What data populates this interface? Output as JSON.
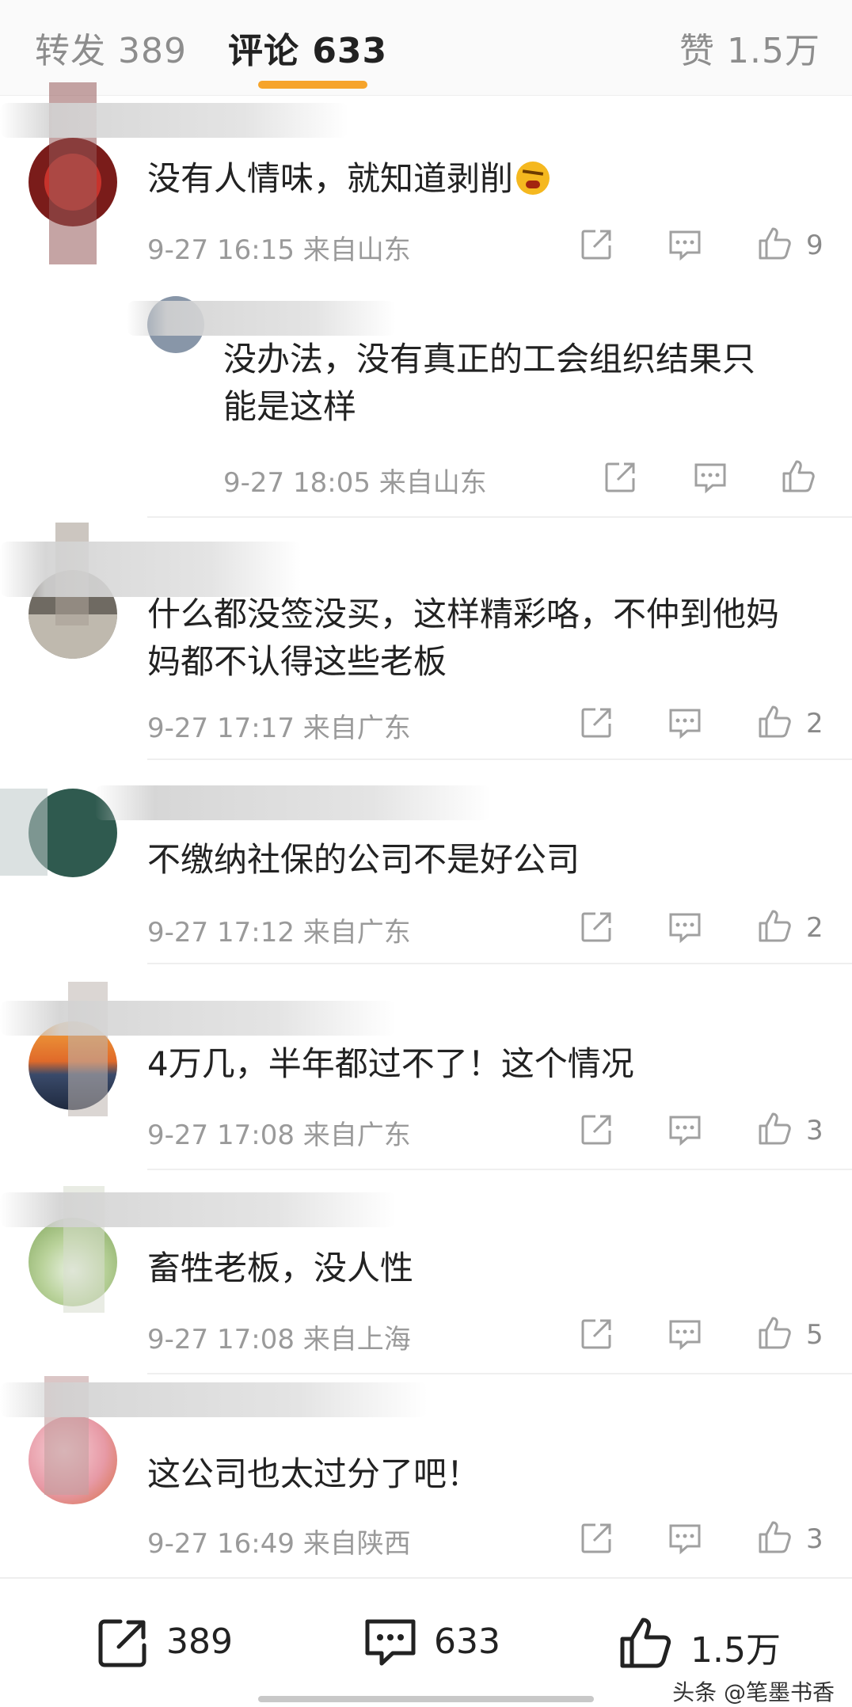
{
  "tabs": {
    "forward": "转发 389",
    "comments": "评论 633",
    "likes": "赞 1.5万"
  },
  "comments": [
    {
      "text": "没有人情味，就知道剥削",
      "time": "9-27 16:15",
      "location": "来自山东",
      "likes": "9"
    },
    {
      "text_line1": "没办法，没有真正的工会组织结果只",
      "text_line2": "能是这样",
      "time": "9-27 18:05",
      "location": "来自山东",
      "likes": ""
    },
    {
      "text_line1": "什么都没签没买，这样精彩咯，不仲到他妈",
      "text_line2": "妈都不认得这些老板",
      "time": "9-27 17:17",
      "location": "来自广东",
      "likes": "2"
    },
    {
      "text": "不缴纳社保的公司不是好公司",
      "time": "9-27 17:12",
      "location": "来自广东",
      "likes": "2"
    },
    {
      "text": "4万几，半年都过不了！这个情况",
      "time": "9-27 17:08",
      "location": "来自广东",
      "likes": "3"
    },
    {
      "text": "畜牲老板，没人性",
      "time": "9-27 17:08",
      "location": "来自上海",
      "likes": "5"
    },
    {
      "text": "这公司也太过分了吧！",
      "time": "9-27 16:49",
      "location": "来自陕西",
      "likes": "3"
    }
  ],
  "bottom_bar": {
    "share_count": "389",
    "comment_count": "633",
    "like_count": "1.5万"
  },
  "watermark": "头条 @笔墨书香",
  "colors": {
    "accent": "#f6a42a",
    "meta_text": "#9a9a9a",
    "icon": "#a0a0a0"
  }
}
